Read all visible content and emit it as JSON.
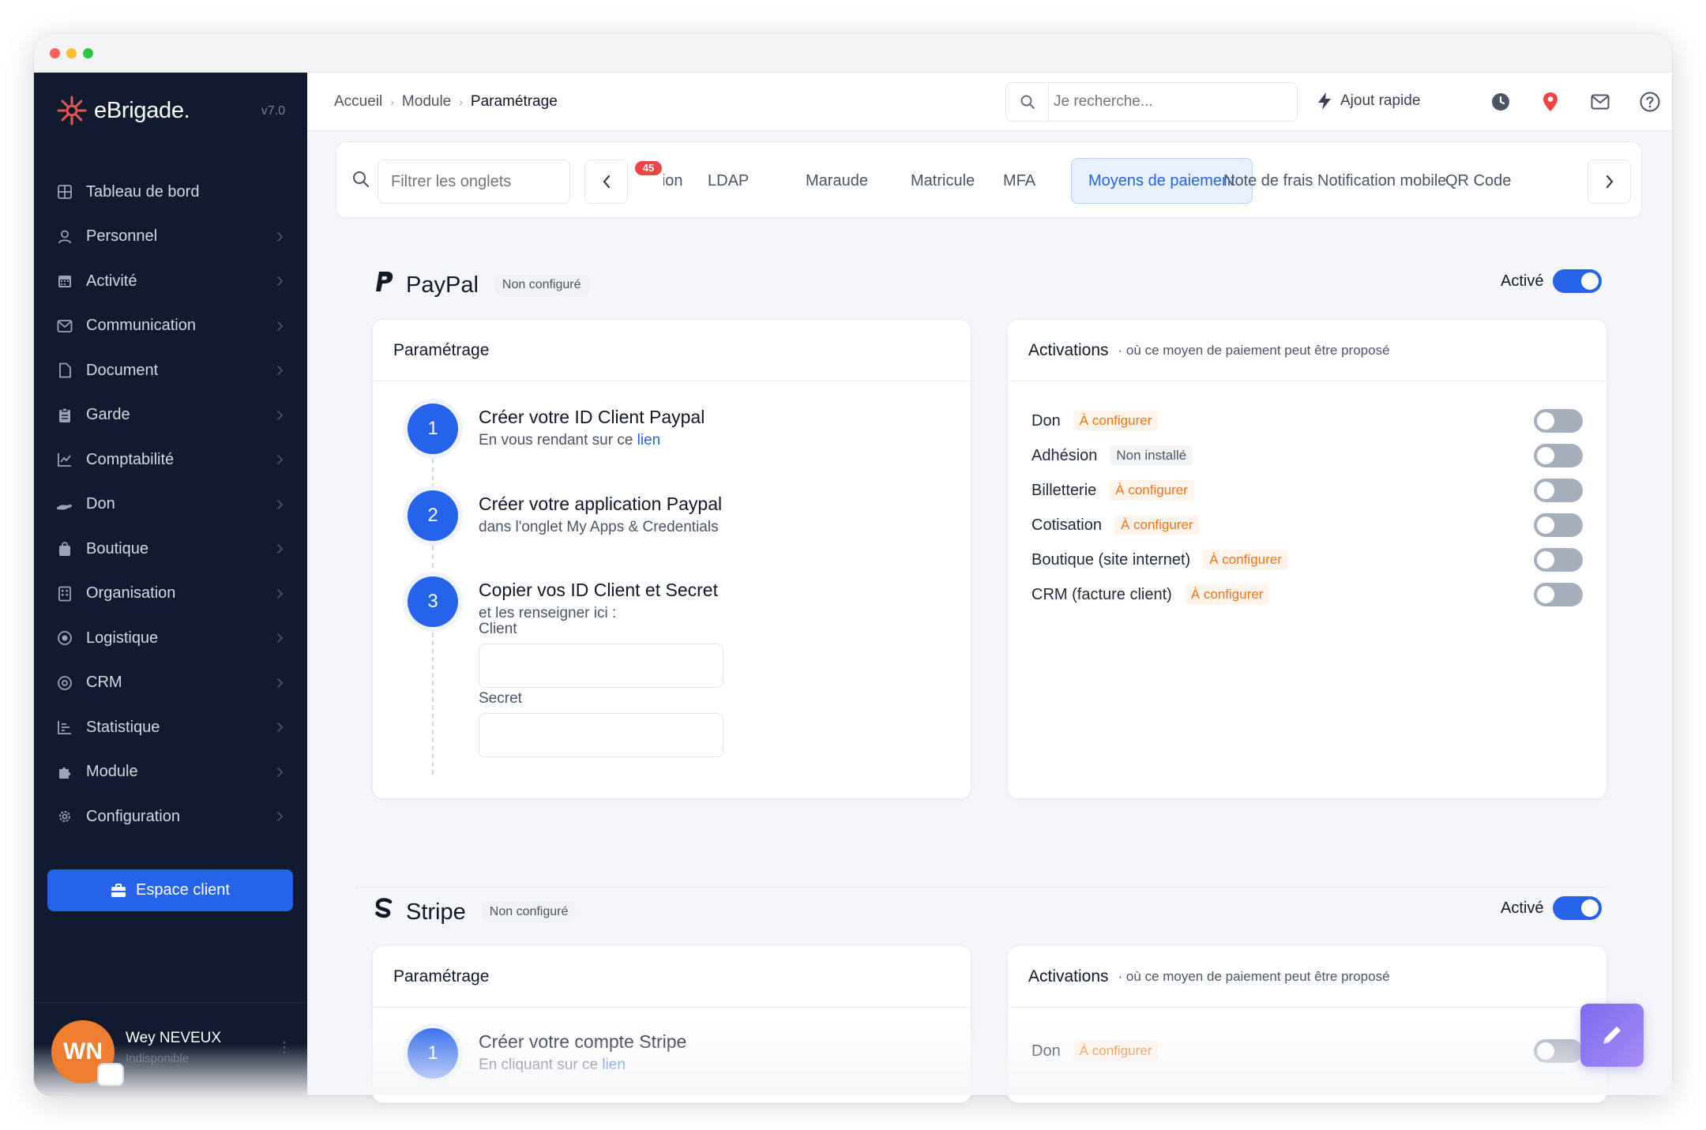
{
  "sidebar": {
    "logo_text": "eBrigade.",
    "version": "v7.0",
    "items": [
      {
        "label": "Tableau de bord",
        "icon": "grid-icon",
        "chevron": false
      },
      {
        "label": "Personnel",
        "icon": "user-icon",
        "chevron": true
      },
      {
        "label": "Activité",
        "icon": "calendar-icon",
        "chevron": true
      },
      {
        "label": "Communication",
        "icon": "envelope-icon",
        "chevron": true
      },
      {
        "label": "Document",
        "icon": "file-icon",
        "chevron": true
      },
      {
        "label": "Garde",
        "icon": "clipboard-icon",
        "chevron": true
      },
      {
        "label": "Comptabilité",
        "icon": "line-chart-icon",
        "chevron": true
      },
      {
        "label": "Don",
        "icon": "hand-icon",
        "chevron": true
      },
      {
        "label": "Boutique",
        "icon": "bag-icon",
        "chevron": true
      },
      {
        "label": "Organisation",
        "icon": "building-icon",
        "chevron": true
      },
      {
        "label": "Logistique",
        "icon": "target-icon",
        "chevron": true
      },
      {
        "label": "CRM",
        "icon": "at-icon",
        "chevron": true
      },
      {
        "label": "Statistique",
        "icon": "bar-list-icon",
        "chevron": true
      },
      {
        "label": "Module",
        "icon": "puzzle-icon",
        "chevron": true
      },
      {
        "label": "Configuration",
        "icon": "gear-icon",
        "chevron": true
      }
    ],
    "client_button": "Espace client",
    "user": {
      "initials": "WN",
      "name": "Wey NEVEUX",
      "status": "Indisponible"
    }
  },
  "header": {
    "breadcrumb": [
      "Accueil",
      "Module",
      "Paramétrage"
    ],
    "search_placeholder": "Je recherche...",
    "quick_add": "Ajout rapide"
  },
  "tabs": {
    "filter_placeholder": "Filtrer les onglets",
    "items": [
      "Intégration",
      "LDAP",
      "Maraude",
      "Matricule",
      "MFA",
      "Moyens de paiement",
      "Note de frais",
      "Notification mobile",
      "QR Code"
    ],
    "active": "Moyens de paiement",
    "count_badge": "45"
  },
  "sections": {
    "paypal": {
      "title": "PayPal",
      "status": "Non configuré",
      "toggle_label": "Activé",
      "param_title": "Paramétrage",
      "steps": [
        {
          "num": "1",
          "title": "Créer votre ID Client Paypal",
          "desc": "En vous rendant sur ce ",
          "link": "lien"
        },
        {
          "num": "2",
          "title": "Créer votre application Paypal",
          "desc": "dans l'onglet My Apps & Credentials"
        },
        {
          "num": "3",
          "title": "Copier vos ID Client et Secret",
          "desc": "et les renseigner ici :"
        }
      ],
      "client_label": "Client",
      "secret_label": "Secret",
      "activations_title": "Activations",
      "activations_sub": "· où ce moyen de paiement peut être proposé",
      "activations": [
        {
          "label": "Don",
          "badge": "À configurer",
          "kind": "warn"
        },
        {
          "label": "Adhésion",
          "badge": "Non installé",
          "kind": "muted"
        },
        {
          "label": "Billetterie",
          "badge": "À configurer",
          "kind": "warn"
        },
        {
          "label": "Cotisation",
          "badge": "À configurer",
          "kind": "warn"
        },
        {
          "label": "Boutique (site internet)",
          "badge": "À configurer",
          "kind": "warn"
        },
        {
          "label": "CRM (facture client)",
          "badge": "À configurer",
          "kind": "warn"
        }
      ]
    },
    "stripe": {
      "title": "Stripe",
      "status": "Non configuré",
      "toggle_label": "Activé",
      "param_title": "Paramétrage",
      "step1_num": "1",
      "step1_title": "Créer votre compte Stripe",
      "step1_desc": "En cliquant sur ce ",
      "step1_link": "lien",
      "activations_title": "Activations",
      "activations_sub": "· où ce moyen de paiement peut être proposé",
      "first_activation": {
        "label": "Don",
        "badge": "À configurer"
      }
    }
  },
  "colors": {
    "accent": "#2563eb",
    "sidebar_bg": "#111a2e",
    "warning": "#f97316",
    "avatar": "#ef7d2f"
  }
}
